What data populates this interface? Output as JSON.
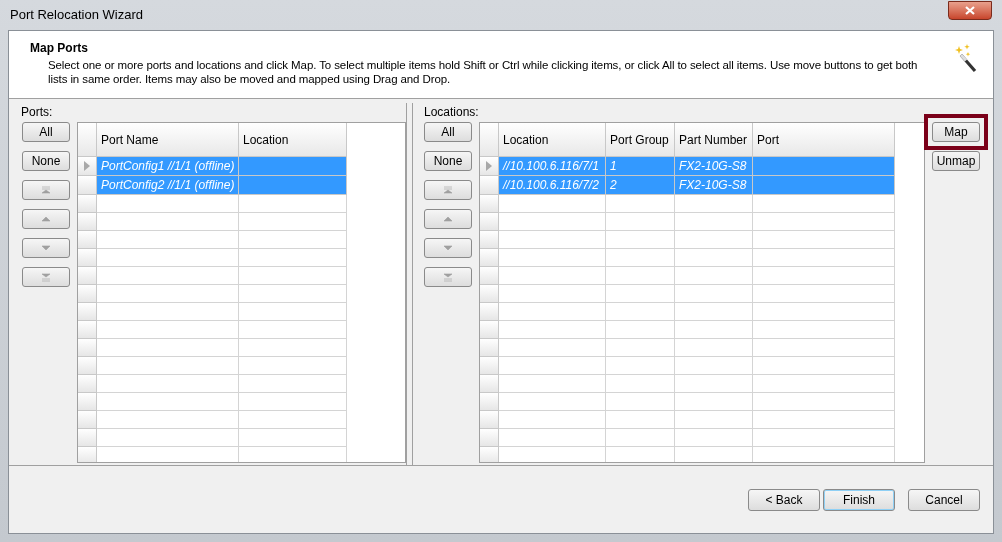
{
  "window": {
    "title": "Port Relocation Wizard"
  },
  "header": {
    "title": "Map Ports",
    "description": "Select one or more ports and locations and click Map. To select multiple items hold Shift or Ctrl while clicking items, or click All to select all items. Use move buttons to get both lists in same order. Items may also be moved and mapped using Drag and Drop."
  },
  "ports": {
    "label": "Ports:",
    "select_buttons": [
      "All",
      "None"
    ],
    "columns": [
      "Port Name",
      "Location"
    ],
    "rows": [
      {
        "cells": [
          "PortConfig1 //1/1 (offline)",
          ""
        ],
        "selected": true,
        "current": true
      },
      {
        "cells": [
          "PortConfig2 //1/1 (offline)",
          ""
        ],
        "selected": true,
        "current": false
      }
    ]
  },
  "locations": {
    "label": "Locations:",
    "select_buttons": [
      "All",
      "None"
    ],
    "columns": [
      "Location",
      "Port Group",
      "Part Number",
      "Port"
    ],
    "rows": [
      {
        "cells": [
          "//10.100.6.116/7/1",
          "1",
          "FX2-10G-S8",
          ""
        ],
        "selected": true,
        "current": true
      },
      {
        "cells": [
          "//10.100.6.116/7/2",
          "2",
          "FX2-10G-S8",
          ""
        ],
        "selected": true,
        "current": false
      }
    ]
  },
  "map_buttons": [
    {
      "label": "Map",
      "highlighted": true
    },
    {
      "label": "Unmap",
      "highlighted": false
    }
  ],
  "footer_buttons": [
    {
      "label": "< Back",
      "focused": false
    },
    {
      "label": "Finish",
      "focused": true
    },
    {
      "label": "Cancel",
      "focused": false
    }
  ]
}
